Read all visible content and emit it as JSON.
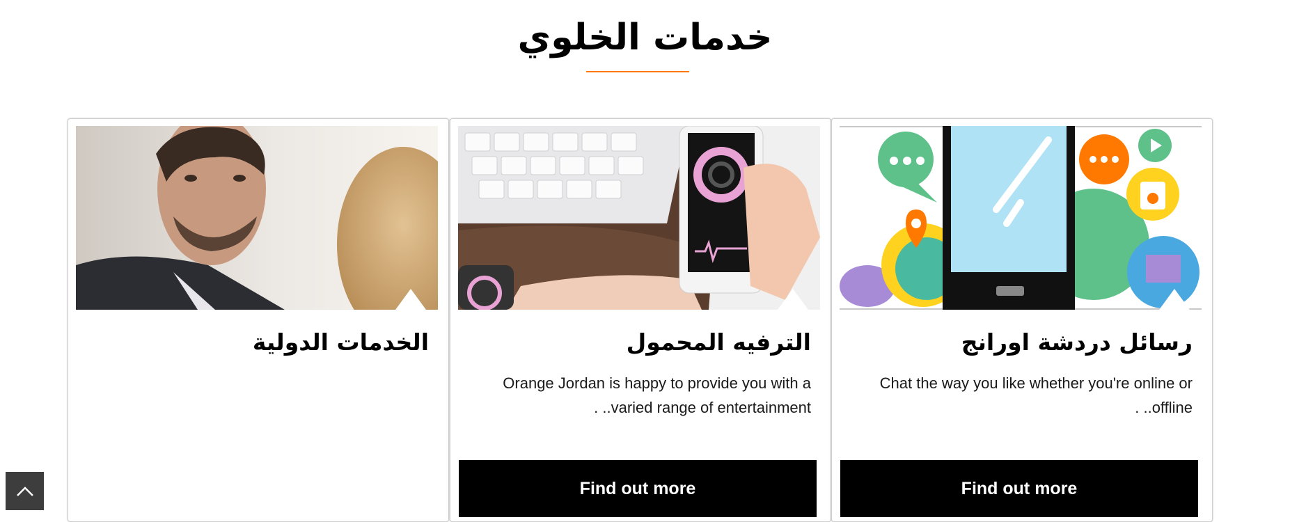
{
  "section": {
    "title": "خدمات الخلوي"
  },
  "cards": [
    {
      "image_alt": "man-talking",
      "title": "الخدمات الدولية",
      "description": "",
      "button": ""
    },
    {
      "image_alt": "phone-and-watch",
      "title": "الترفيه المحمول",
      "description": "Orange Jordan is happy to provide you with a varied range of entertainment.. .",
      "button": "Find out more"
    },
    {
      "image_alt": "chat-apps-illustration",
      "title": "رسائل دردشة اورانج",
      "description": "Chat the way you like whether you're online or offline.. .",
      "button": "Find out more"
    }
  ],
  "colors": {
    "accent": "#ff7900",
    "button": "#000000"
  },
  "icons": {
    "back_to_top": "chevron-up-icon"
  }
}
